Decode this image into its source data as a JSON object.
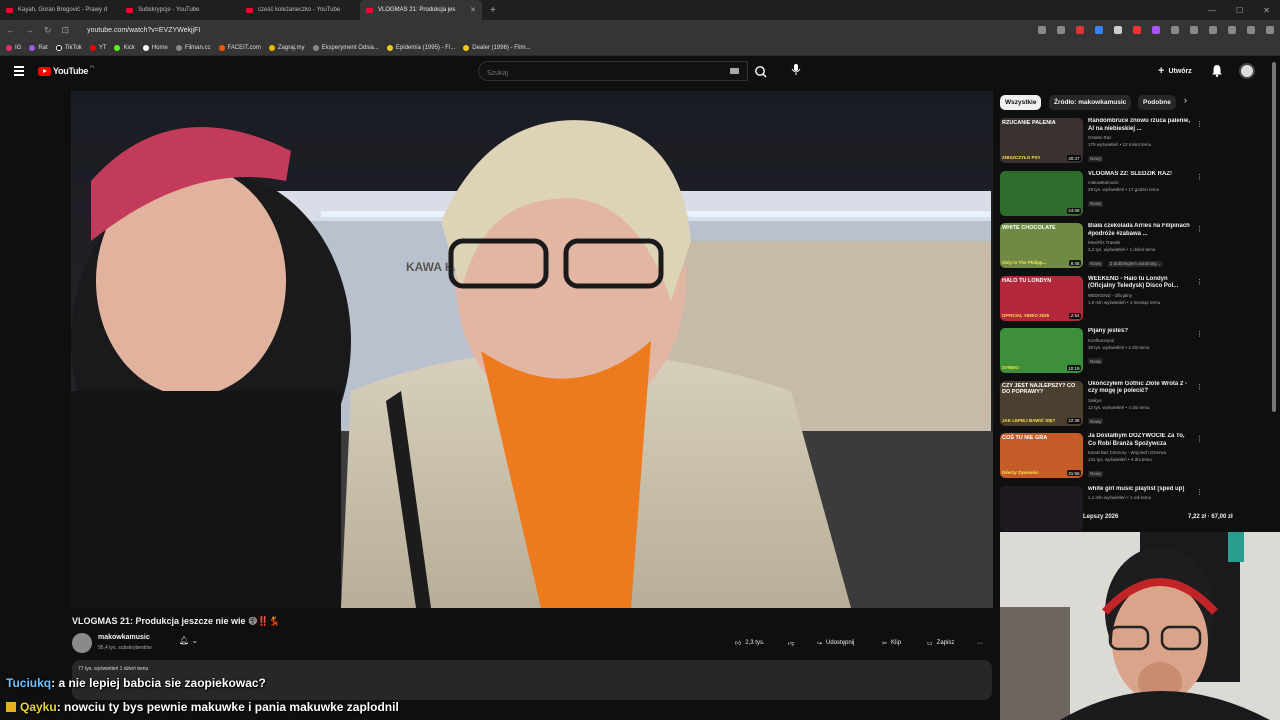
{
  "browser": {
    "tabs": [
      {
        "title": "Kayah, Goran Bregović - Prawy d"
      },
      {
        "title": "Subskrypcje - YouTube"
      },
      {
        "title": "cześć koleżaneczko - YouTube"
      },
      {
        "title": "VLOGMAS 21: Produkcja jes"
      }
    ],
    "url": "youtube.com/watch?v=EVZYWekjjFI",
    "bookmarks": [
      "IG",
      "Rat",
      "TikTok",
      "YT",
      "Kick",
      "Home",
      "Filman.cc",
      "FACEIT.com",
      "Zagraj.my",
      "Eksperyment Odsia...",
      "Epidemia (1995) - Fi...",
      "Dealer (1996) - Film..."
    ]
  },
  "youtube": {
    "logo_text": "YouTube",
    "country": "PL",
    "search_placeholder": "Szukaj",
    "create_label": "Utwórz"
  },
  "video": {
    "title": "VLOGMAS 21: Produkcja jeszcze nie wie 😅‼️💃",
    "sign_text": "KAWA HERBATA GORĄCA CZEKO",
    "channel": "makowkamusic",
    "subscribers": "95,4 tys. subskrybentów",
    "likes": "2,3 tys.",
    "share_label": "Udostępnij",
    "clip_label": "Klip",
    "save_label": "Zapisz",
    "views_line": "77 tys. wyświetleń  1 dzień temu"
  },
  "sidebar": {
    "chips": [
      "Wszystkie",
      "Źródło: makowkamusic",
      "Podobne"
    ],
    "recommendations": [
      {
        "title": "Randombruce znowu rzuca palenie, AI na niebieskiej ...",
        "channel": "Ostatni Raz",
        "meta": "179 wyświetleń • 12 minut temu",
        "badge": "Nowy",
        "duration": "30:47",
        "thumb_text": "RZUCANIE PALENIA",
        "thumb_sub": "ZNISZCZYŁO PSY"
      },
      {
        "title": "VLOGMAS 22: ŚLEDZIK RAZ!",
        "channel": "makowkamusic",
        "meta": "29 tys. wyświetleń • 17 godzin temu",
        "badge": "Nowy",
        "duration": "24:08",
        "thumb_text": "",
        "thumb_sub": ""
      },
      {
        "title": "Biała czekolada Arries na Filipinach #podróże #zabawa ...",
        "channel": "MexiFils Travels",
        "meta": "3,2 tys. wyświetleń • 1 dzień temu",
        "badge": "Nowy",
        "badge2": "Z dubbingiem automaty...",
        "duration": "8:45",
        "thumb_text": "WHITE CHOCOLATE",
        "thumb_sub": "Only in The Philipp..."
      },
      {
        "title": "WEEKEND - Halo tu Londyn (Oficjalny Teledysk) Disco Pol...",
        "channel": "WEEKEND - Oficjalny",
        "meta": "1,9 mln wyświetleń • 1 miesiąc temu",
        "badge": "",
        "duration": "2:54",
        "thumb_text": "HALO TU LONDYN",
        "thumb_sub": "OFFICIAL VIDEO 2025"
      },
      {
        "title": "Pijany jesteś?",
        "channel": "Konfiturexpol",
        "meta": "39 tys. wyświetleń • 2 dni temu",
        "badge": "Nowy",
        "duration": "10:19",
        "thumb_text": "",
        "thumb_sub": "SYNEK!"
      },
      {
        "title": "Ukończyłem Gothic Złote Wrota 2 - czy mogę je polecić?",
        "channel": "Saikyo",
        "meta": "12 tys. wyświetleń • 4 dni temu",
        "badge": "Nowy",
        "duration": "22:39",
        "thumb_text": "CZY JEST NAJLEPSZY? CO DO POPRAWY?",
        "thumb_sub": "JAK LEPIEJ BAWIĆ SIĘ?"
      },
      {
        "title": "Ja Dostałbym DOŻYWOCIE Za To, Co Robi Branża Spożywcza",
        "channel": "Kanał Bez Cenzury - Wojciech Dzierwa",
        "meta": "131 tys. wyświetleń • 4 dni temu",
        "badge": "Nowy",
        "duration": "31:56",
        "thumb_text": "COŚ TU NIE GRA",
        "thumb_sub": "Dilerzy Żywności"
      },
      {
        "title": "white girl music playlist [sped up]",
        "channel": "",
        "meta": "1,1 mln wyświetleń • 1 rok temu",
        "badge": "",
        "duration": "",
        "thumb_text": "",
        "thumb_sub": ""
      }
    ]
  },
  "overlay": {
    "price_label": "Lepszy 2026",
    "price_values": "7,22 zł  ·  67,00 zł",
    "chat": [
      {
        "user": "Tuciukq",
        "user_color": "#6ec1ff",
        "message": ": a nie lepiej babcia sie zaopiekowac?"
      },
      {
        "user": "Qayku",
        "user_color": "#e8d33c",
        "message": ": nowciu ty bys pewnie makuwke i pania makuwke zaplodnil"
      }
    ]
  },
  "colors": {
    "bg": "#0f0f0f",
    "accent": "#ff0000",
    "chip_active": "#f1f1f1"
  }
}
